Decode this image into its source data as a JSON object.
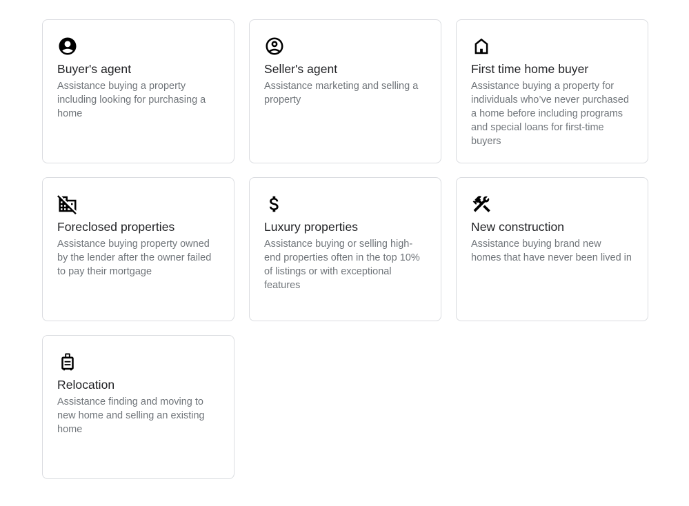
{
  "services": [
    {
      "icon": "account-circle-icon",
      "title": "Buyer's agent",
      "description": "Assistance buying a property including looking for purchasing a home"
    },
    {
      "icon": "account-circle-outline-icon",
      "title": "Seller's agent",
      "description": "Assistance marketing and selling a property"
    },
    {
      "icon": "home-icon",
      "title": "First time home buyer",
      "description": "Assistance buying a property for individuals who’ve never purchased a home before including programs and special loans for first-time buyers"
    },
    {
      "icon": "domain-disabled-icon",
      "title": "Foreclosed properties",
      "description": "Assistance buying property owned by the lender after the owner failed to pay their mortgage"
    },
    {
      "icon": "dollar-icon",
      "title": "Luxury properties",
      "description": "Assistance buying or selling high-end properties often in the top 10% of listings or with exceptional features"
    },
    {
      "icon": "construction-tools-icon",
      "title": "New construction",
      "description": "Assistance buying brand new homes that have never been lived in"
    },
    {
      "icon": "luggage-icon",
      "title": "Relocation",
      "description": "Assistance finding and moving to new home and selling an existing home"
    }
  ]
}
